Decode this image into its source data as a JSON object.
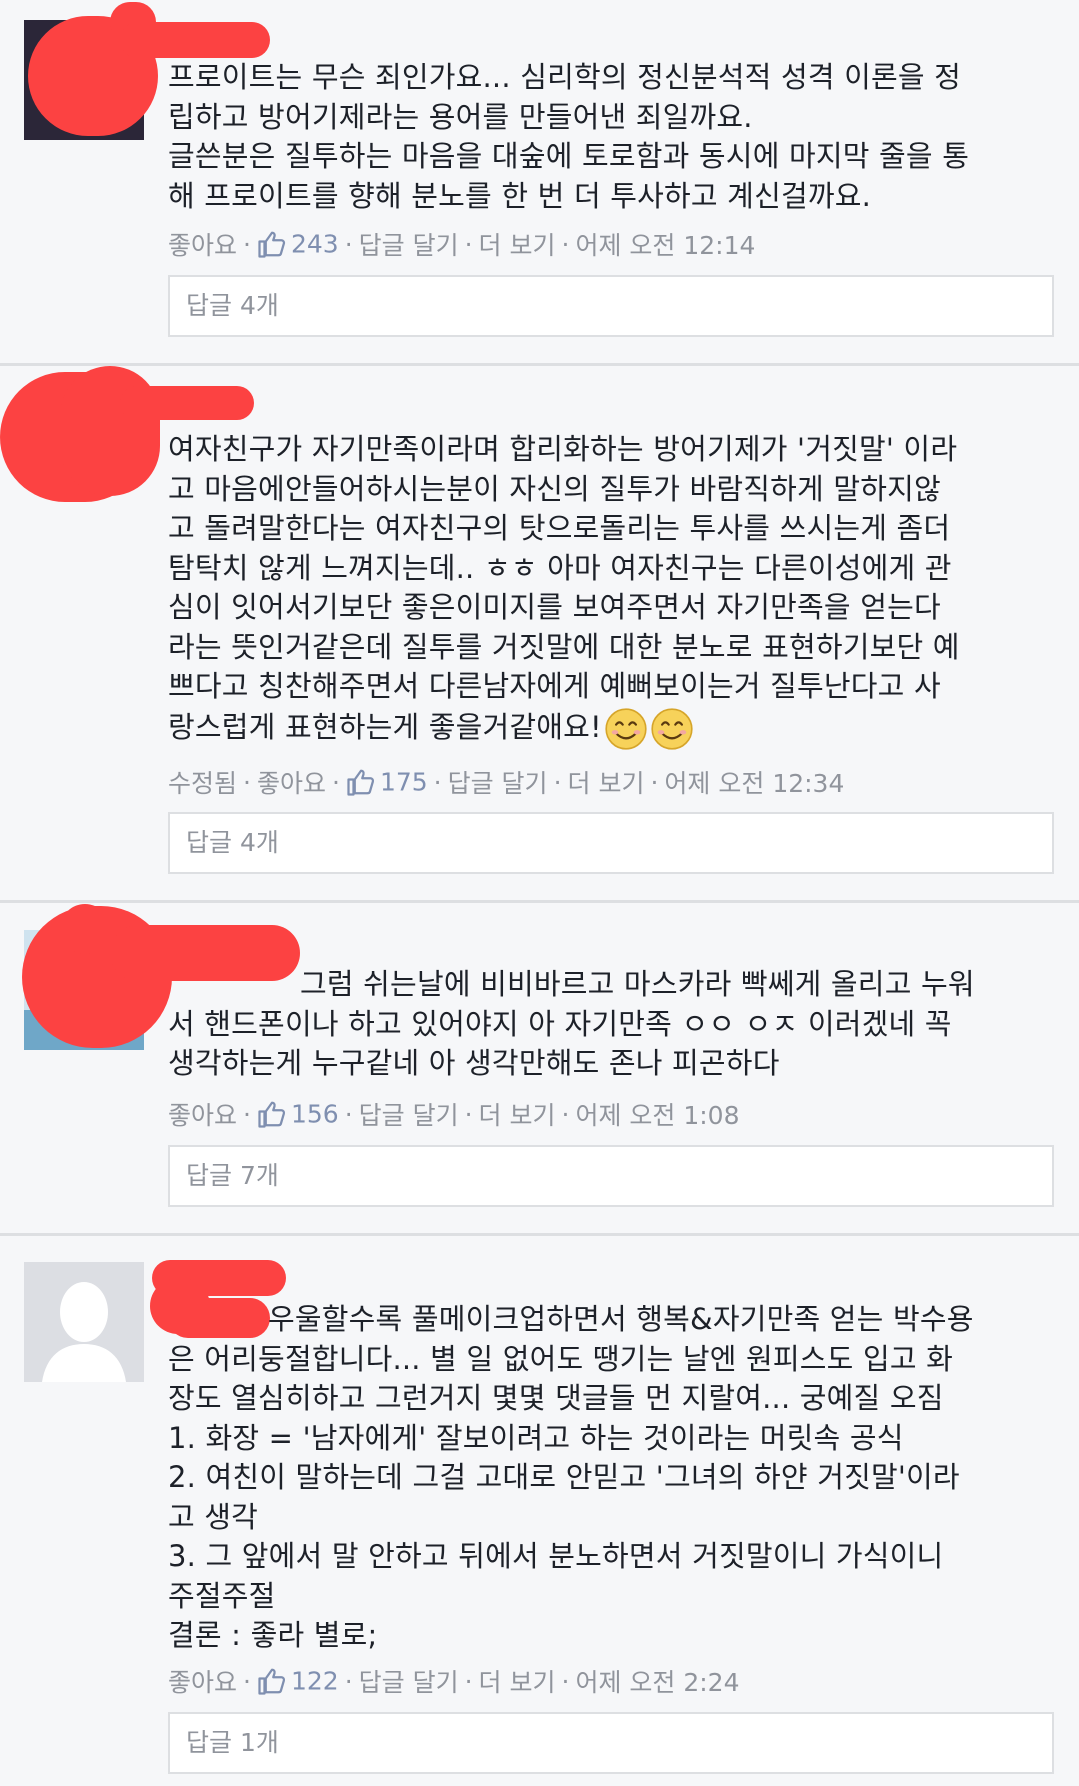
{
  "comments": [
    {
      "text": "프로이트는 무슨 죄인가요... 심리학의 정신분석적 성격 이론을 정\n립하고 방어기제라는 용어를 만들어낸 죄일까요.\n글쓴분은 질투하는 마음을 대숲에 토로함과 동시에 마지막 줄을 통\n해 프로이트를 향해 분노를 한 번 더 투사하고 계신걸까요.",
      "edited": "",
      "like": "좋아요",
      "like_count": "243",
      "reply": "답글 달기",
      "more": "더 보기",
      "time": "어제 오전 12:14",
      "replies": "답글 4개"
    },
    {
      "text": "여자친구가 자기만족이라며 합리화하는 방어기제가 '거짓말' 이라\n고 마음에안들어하시는분이 자신의 질투가 바람직하게 말하지않\n고 돌려말한다는 여자친구의 탓으로돌리는 투사를 쓰시는게 좀더\n탐탁치 않게 느껴지는데.. ㅎㅎ 아마 여자친구는 다른이성에게 관\n심이 잇어서기보단 좋은이미지를 보여주면서 자기만족을 얻는다\n라는 뜻인거같은데 질투를 거짓말에 대한 분노로 표현하기보단 예\n쁘다고 칭찬해주면서 다른남자에게 예뻐보이는거 질투난다고 사\n랑스럽게 표현하는게 좋을거같애요!",
      "edited": "수정됨",
      "like": "좋아요",
      "like_count": "175",
      "reply": "답글 달기",
      "more": "더 보기",
      "time": "어제 오전 12:34",
      "replies": "답글 4개"
    },
    {
      "text": "그럼 쉬는날에 비비바르고 마스카라 빡쎄게 올리고 누워\n서 핸드폰이나 하고 있어야지 아 자기만족 ㅇㅇ ㅇㅈ 이러겠네 꼭\n생각하는게 누구같네 아 생각만해도 존나 피곤하다",
      "edited": "",
      "like": "좋아요",
      "like_count": "156",
      "reply": "답글 달기",
      "more": "더 보기",
      "time": "어제 오전 1:08",
      "replies": "답글 7개"
    },
    {
      "text": "우울할수록 풀메이크업하면서 행복&자기만족 얻는 박수용\n은 어리둥절합니다... 별 일 없어도 땡기는 날엔 원피스도 입고 화\n장도 열심히하고 그런거지 몇몇 댓글들 먼 지랄여... 궁예질 오짐\n1. 화장 = '남자에게' 잘보이려고 하는 것이라는 머릿속 공식\n2. 여친이 말하는데 그걸 고대로 안믿고 '그녀의 하얀 거짓말'이라\n고 생각\n3. 그 앞에서 말 안하고 뒤에서 분노하면서 거짓말이니 가식이니\n주절주절\n결론 : 좋라 별로;",
      "edited": "",
      "like": "좋아요",
      "like_count": "122",
      "reply": "답글 달기",
      "more": "더 보기",
      "time": "어제 오전 2:24",
      "replies": "답글 1개"
    }
  ],
  "icons": {
    "like": "thumbs-up-icon",
    "emoji": "smiling-face-icon",
    "avatar_default": "default-avatar-icon"
  },
  "colors": {
    "background": "#f6f7f9",
    "redaction": "#fc4242",
    "meta_text": "#90949c",
    "like_blue": "#7f8fb0"
  }
}
